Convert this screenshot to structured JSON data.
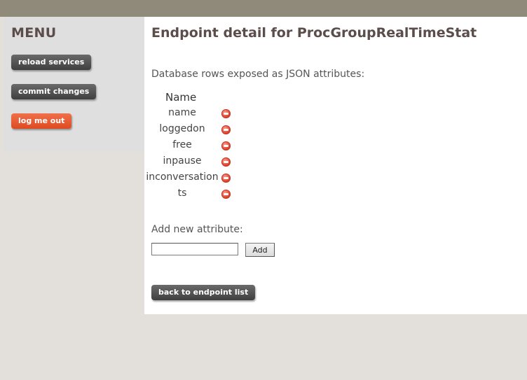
{
  "sidebar": {
    "title": "MENU",
    "buttons": {
      "reload": "reload services",
      "commit": "commit changes",
      "logout": "log me out"
    }
  },
  "main": {
    "title": "Endpoint detail for ProcGroupRealTimeStat",
    "db_rows_label": "Database rows exposed as JSON attributes:",
    "column_header": "Name",
    "attributes": [
      "name",
      "loggedon",
      "free",
      "inpause",
      "inconversation",
      "ts"
    ],
    "add_label": "Add new attribute:",
    "new_attribute_value": "",
    "add_button": "Add",
    "back_button": "back to endpoint list"
  },
  "colors": {
    "topbar": "#908a7a",
    "sidebar_bg": "#dfdfdf",
    "title_text": "#5b4d4a",
    "dark_button": "#4a4a4a",
    "logout_button": "#e4552b",
    "remove_icon": "#e0402c"
  },
  "icons": {
    "remove": "remove-icon"
  }
}
